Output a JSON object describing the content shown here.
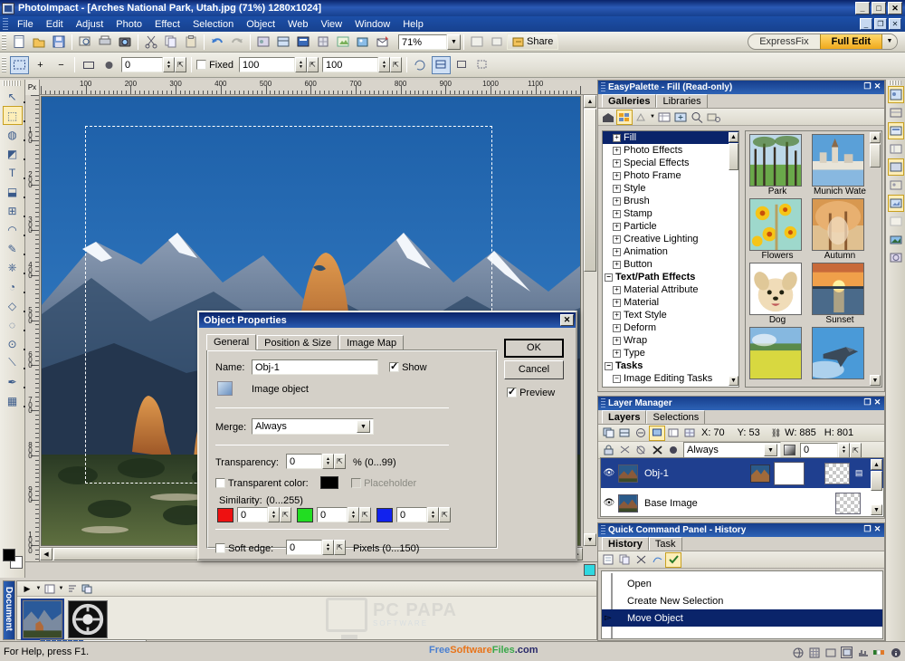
{
  "window": {
    "title": "PhotoImpact - [Arches National Park, Utah.jpg (71%) 1280x1024]",
    "minimize": "_",
    "maximize": "□",
    "close": "✕",
    "doc_minimize": "_",
    "doc_restore": "❐",
    "doc_close": "✕"
  },
  "menu": {
    "items": [
      "File",
      "Edit",
      "Adjust",
      "Photo",
      "Effect",
      "Selection",
      "Object",
      "Web",
      "View",
      "Window",
      "Help"
    ]
  },
  "toolbar": {
    "zoom_value": "71%",
    "share_label": "Share",
    "expressfix_label": "ExpressFix",
    "fulledit_label": "Full Edit",
    "dropdown_glyph": "▼"
  },
  "attrbar": {
    "plus": "+",
    "minus": "−",
    "softness_value": "0",
    "fixed_label": "Fixed",
    "fixed_checked": false,
    "width_value": "100",
    "height_value": "100"
  },
  "ruler": {
    "unit": "Px",
    "h_labels": [
      "100",
      "200",
      "300",
      "400",
      "500",
      "600",
      "700",
      "800",
      "900",
      "1000",
      "1100"
    ],
    "v_labels": [
      "100",
      "200",
      "300",
      "400",
      "500",
      "600",
      "700",
      "800",
      "900",
      "1000"
    ]
  },
  "dialog": {
    "title": "Object Properties",
    "close": "✕",
    "tabs": [
      {
        "label": "General",
        "active": true
      },
      {
        "label": "Position & Size",
        "active": false
      },
      {
        "label": "Image Map",
        "active": false
      }
    ],
    "name_label": "Name:",
    "name_value": "Obj-1",
    "show_label": "Show",
    "show_checked": true,
    "object_type": "Image object",
    "merge_label": "Merge:",
    "merge_value": "Always",
    "transparency_label": "Transparency:",
    "transparency_value": "0",
    "transparency_range": "% (0...99)",
    "transparent_color_label": "Transparent color:",
    "transparent_color_checked": false,
    "transparent_color_swatch": "#000000",
    "placeholder_label": "Placeholder",
    "placeholder_checked": false,
    "similarity_label": "Similarity:",
    "similarity_range": "(0...255)",
    "similarity_channels": [
      {
        "color": "#ee1111",
        "value": "0"
      },
      {
        "color": "#22dd22",
        "value": "0"
      },
      {
        "color": "#1122ee",
        "value": "0"
      }
    ],
    "soft_edge_label": "Soft edge:",
    "soft_edge_checked": false,
    "soft_edge_value": "0",
    "soft_edge_range": "Pixels (0...150)",
    "ok_label": "OK",
    "cancel_label": "Cancel",
    "preview_label": "Preview",
    "preview_checked": true
  },
  "easypalette": {
    "title": "EasyPalette - Fill (Read-only)",
    "tabs": [
      {
        "label": "Galleries",
        "active": true
      },
      {
        "label": "Libraries",
        "active": false
      }
    ],
    "tree": [
      {
        "label": "Fill",
        "exp": "+",
        "indent": 1,
        "selected": true,
        "bold": false
      },
      {
        "label": "Photo Effects",
        "exp": "+",
        "indent": 1,
        "selected": false,
        "bold": false
      },
      {
        "label": "Special Effects",
        "exp": "+",
        "indent": 1,
        "selected": false,
        "bold": false
      },
      {
        "label": "Photo Frame",
        "exp": "+",
        "indent": 1,
        "selected": false,
        "bold": false
      },
      {
        "label": "Style",
        "exp": "+",
        "indent": 1,
        "selected": false,
        "bold": false
      },
      {
        "label": "Brush",
        "exp": "+",
        "indent": 1,
        "selected": false,
        "bold": false
      },
      {
        "label": "Stamp",
        "exp": "+",
        "indent": 1,
        "selected": false,
        "bold": false
      },
      {
        "label": "Particle",
        "exp": "+",
        "indent": 1,
        "selected": false,
        "bold": false
      },
      {
        "label": "Creative Lighting",
        "exp": "+",
        "indent": 1,
        "selected": false,
        "bold": false
      },
      {
        "label": "Animation",
        "exp": "+",
        "indent": 1,
        "selected": false,
        "bold": false
      },
      {
        "label": "Button",
        "exp": "+",
        "indent": 1,
        "selected": false,
        "bold": false
      },
      {
        "label": "Text/Path Effects",
        "exp": "−",
        "indent": 0,
        "selected": false,
        "bold": true
      },
      {
        "label": "Material Attribute",
        "exp": "+",
        "indent": 1,
        "selected": false,
        "bold": false
      },
      {
        "label": "Material",
        "exp": "+",
        "indent": 1,
        "selected": false,
        "bold": false
      },
      {
        "label": "Text Style",
        "exp": "+",
        "indent": 1,
        "selected": false,
        "bold": false
      },
      {
        "label": "Deform",
        "exp": "+",
        "indent": 1,
        "selected": false,
        "bold": false
      },
      {
        "label": "Wrap",
        "exp": "+",
        "indent": 1,
        "selected": false,
        "bold": false
      },
      {
        "label": "Type",
        "exp": "+",
        "indent": 1,
        "selected": false,
        "bold": false
      },
      {
        "label": "Tasks",
        "exp": "−",
        "indent": 0,
        "selected": false,
        "bold": true
      },
      {
        "label": "Image Editing Tasks",
        "exp": "−",
        "indent": 1,
        "selected": false,
        "bold": false
      }
    ],
    "thumbs": [
      {
        "label": "Park",
        "kind": "park"
      },
      {
        "label": "Munich Wate",
        "kind": "munich"
      },
      {
        "label": "Flowers",
        "kind": "flowers"
      },
      {
        "label": "Autumn",
        "kind": "autumn"
      },
      {
        "label": "Dog",
        "kind": "dog"
      },
      {
        "label": "Sunset",
        "kind": "sunset"
      },
      {
        "label": "",
        "kind": "field"
      },
      {
        "label": "",
        "kind": "jet"
      }
    ]
  },
  "layermanager": {
    "title": "Layer Manager",
    "tabs": [
      {
        "label": "Layers",
        "active": true
      },
      {
        "label": "Selections",
        "active": false
      }
    ],
    "x_label": "X:",
    "x_value": "70",
    "y_label": "Y:",
    "y_value": "53",
    "w_label": "W:",
    "w_value": "885",
    "h_label": "H:",
    "h_value": "801",
    "merge_mode": "Always",
    "opacity_value": "0",
    "layers": [
      {
        "name": "Obj-1",
        "selected": true
      },
      {
        "name": "Base Image",
        "selected": false
      }
    ]
  },
  "quickcommand": {
    "title": "Quick Command Panel - History",
    "tabs": [
      {
        "label": "History",
        "active": true
      },
      {
        "label": "Task",
        "active": false
      }
    ],
    "history": [
      {
        "label": "Open",
        "selected": false
      },
      {
        "label": "Create New Selection",
        "selected": false
      },
      {
        "label": "Move Object",
        "selected": true
      }
    ]
  },
  "docstrip": {
    "vertical_label": "Document",
    "close": "✕",
    "thumbs": [
      {
        "kind": "arches",
        "selected": true
      },
      {
        "kind": "wheel",
        "selected": false
      }
    ]
  },
  "watermarks": {
    "pcpapa_text": "PC PAPA",
    "pcpapa_sub": "SOFTWARE",
    "fsf_parts": [
      {
        "text": "Free",
        "color": "#4a7fd0"
      },
      {
        "text": "Software",
        "color": "#e8741a"
      },
      {
        "text": "Files",
        "color": "#3aa84a"
      },
      {
        "text": ".com",
        "color": "#2a2a6a"
      }
    ]
  },
  "statusbar": {
    "hint": "For Help, press F1."
  },
  "toolbox": {
    "tools": [
      {
        "name": "pick-tool",
        "glyph": "↖",
        "selected": false
      },
      {
        "name": "selection-tool",
        "glyph": "⬚",
        "selected": true
      },
      {
        "name": "web-tool",
        "glyph": "◍",
        "selected": false
      },
      {
        "name": "path-tool",
        "glyph": "◩",
        "selected": false
      },
      {
        "name": "text-tool",
        "glyph": "T",
        "selected": false
      },
      {
        "name": "transform-tool",
        "glyph": "⬓",
        "selected": false
      },
      {
        "name": "table-tool",
        "glyph": "⊞",
        "selected": false
      },
      {
        "name": "retouch-tool",
        "glyph": "◠",
        "selected": false
      },
      {
        "name": "paintbrush-tool",
        "glyph": "✎",
        "selected": false
      },
      {
        "name": "clone-tool",
        "glyph": "⎈",
        "selected": false
      },
      {
        "name": "bucket-tool",
        "glyph": "◔",
        "selected": false
      },
      {
        "name": "eraser-tool",
        "glyph": "◇",
        "selected": false
      },
      {
        "name": "shape-tool",
        "glyph": "◌",
        "selected": false
      },
      {
        "name": "zoom-tool",
        "glyph": "⊙",
        "selected": false
      },
      {
        "name": "eyedropper-tool",
        "glyph": "⟍",
        "selected": false
      },
      {
        "name": "pen-tool",
        "glyph": "✒",
        "selected": false
      },
      {
        "name": "mask-tool",
        "glyph": "▦",
        "selected": false
      }
    ]
  }
}
